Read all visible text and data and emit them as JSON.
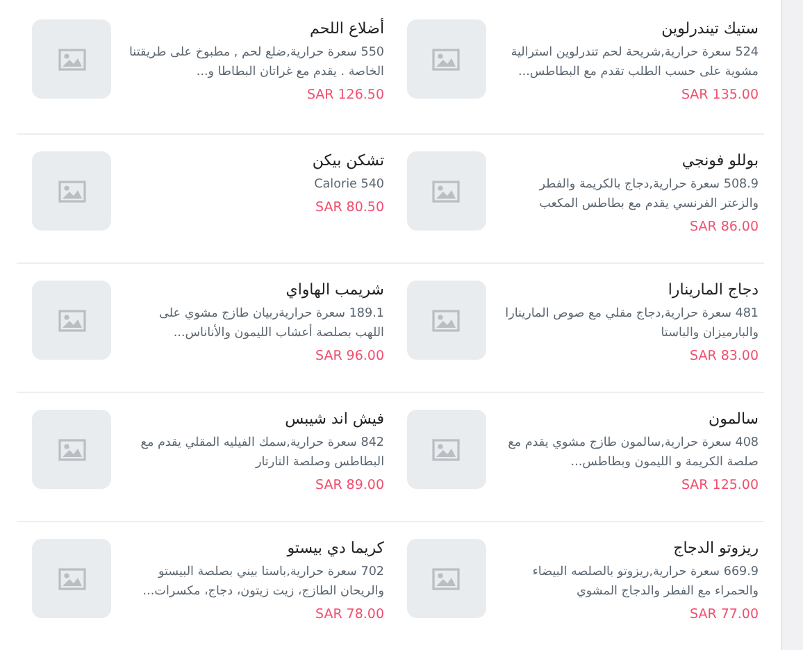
{
  "rows": [
    {
      "items": [
        {
          "name": "ستيك تيندرلوين",
          "description": "524 سعرة حرارية,شريحة لحم تندرلوين استرالية مشوية على حسب الطلب تقدم مع البطاطس...",
          "price": "SAR 135.00"
        },
        {
          "name": "أضلاع اللحم",
          "description": "550 سعرة حرارية,ضلع لحم , مطبوخ على طريقتنا الخاصة . يقدم مع غراتان البطاطا و...",
          "price": "SAR 126.50"
        }
      ]
    },
    {
      "items": [
        {
          "name": "بوللو فونجي",
          "description": "508.9 سعرة حرارية,دجاج بالكريمة والفطر والزعتر الفرنسي يقدم مع بطاطس المكعب",
          "price": "SAR 86.00"
        },
        {
          "name": "تشكن بيكن",
          "description": "Calorie 540",
          "price": "SAR 80.50"
        }
      ]
    },
    {
      "items": [
        {
          "name": "دجاج المارينارا",
          "description": "481 سعرة حرارية,دجاج مقلي مع صوص المارينارا والبارميزان والباستا",
          "price": "SAR 83.00"
        },
        {
          "name": "شريمب الهاواي",
          "description": "189.1 سعرة حراريةربيان طازج مشوي على اللهب بصلصة أعشاب الليمون والأناناس...",
          "price": "SAR 96.00"
        }
      ]
    },
    {
      "items": [
        {
          "name": "سالمون",
          "description": "408 سعرة حرارية,سالمون طازج مشوي يقدم مع صلصة الكريمة و الليمون وبطاطس...",
          "price": "SAR 125.00"
        },
        {
          "name": "فيش اند شيبس",
          "description": "842 سعرة حرارية,سمك الفيليه المقلي يقدم مع البطاطس وصلصة التارتار",
          "price": "SAR 89.00"
        }
      ]
    },
    {
      "items": [
        {
          "name": "ريزوتو الدجاج",
          "description": "669.9 سعرة حرارية,ريزوتو بالصلصه البيضاء والحمراء مع الفطر والدجاج المشوي",
          "price": "SAR 77.00"
        },
        {
          "name": "كريما دي بيستو",
          "description": "702 سعرة حرارية,باستا بيني بصلصة البيستو والريحان الطازج، زيت زيتون، دجاج، مكسرات...",
          "price": "SAR 78.00"
        }
      ]
    }
  ]
}
